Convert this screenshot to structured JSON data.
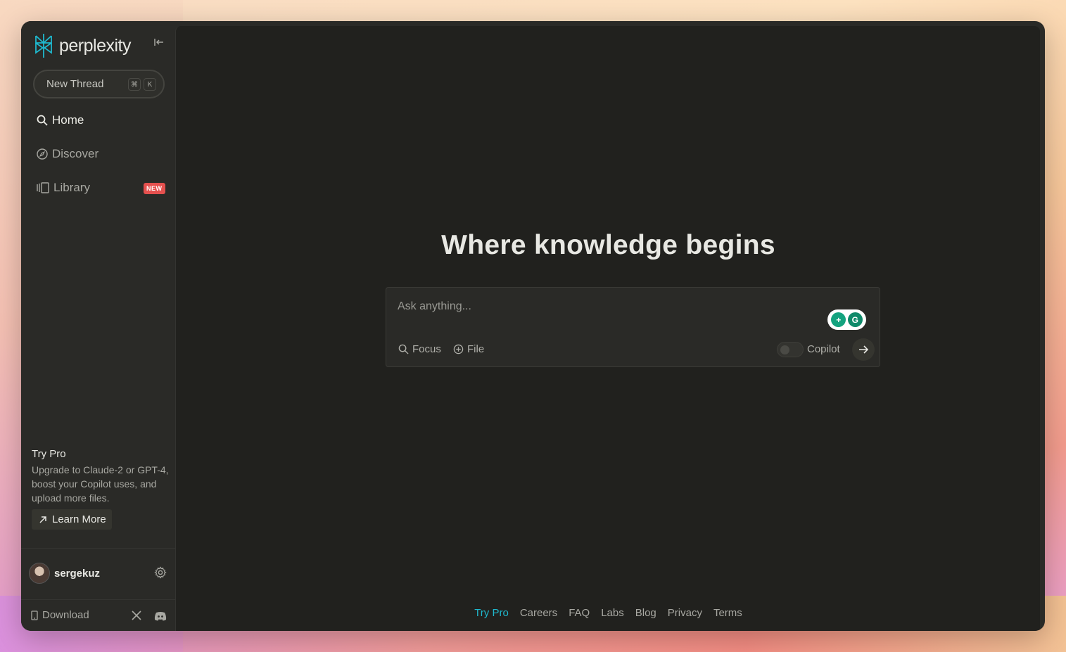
{
  "app": {
    "name": "perplexity"
  },
  "sidebar": {
    "new_thread": {
      "label": "New Thread",
      "kbd_cmd": "⌘",
      "kbd_key": "K"
    },
    "nav": [
      {
        "label": "Home",
        "icon": "search-icon"
      },
      {
        "label": "Discover",
        "icon": "compass-icon"
      },
      {
        "label": "Library",
        "icon": "library-icon",
        "badge": "NEW"
      }
    ],
    "promo": {
      "title": "Try Pro",
      "body": "Upgrade to Claude-2 or GPT-4, boost your Copilot uses, and upload more files.",
      "button": "Learn More"
    },
    "user": {
      "name": "sergekuz"
    },
    "download_label": "Download"
  },
  "main": {
    "hero": "Where knowledge begins",
    "search": {
      "placeholder": "Ask anything...",
      "focus_label": "Focus",
      "file_label": "File",
      "copilot_label": "Copilot",
      "copilot_enabled": false
    },
    "footer_links": [
      "Try Pro",
      "Careers",
      "FAQ",
      "Labs",
      "Blog",
      "Privacy",
      "Terms"
    ]
  },
  "colors": {
    "accent": "#1fb8cd",
    "badge": "#e4504e",
    "sidebar_bg": "#2a2a27",
    "main_bg": "#21211e"
  }
}
